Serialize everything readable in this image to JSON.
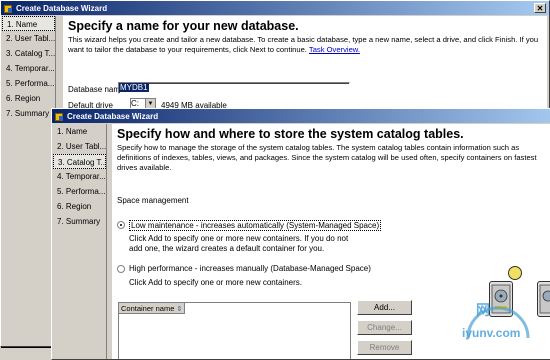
{
  "window_back": {
    "title": "Create Database Wizard",
    "nav": [
      "1. Name",
      "2. User Tabl...",
      "3. Catalog T...",
      "4. Temporar...",
      "5. Performa...",
      "6. Region",
      "7. Summary"
    ],
    "heading": "Specify a name for your new database.",
    "description": "This wizard helps you create and tailor a new database. To create a basic database, type a new name, select a drive, and click Finish. If you want to tailor the database to your requirements, click Next to continue.",
    "link": "Task Overview.",
    "db_name_label": "Database name",
    "db_name_value": "MYDB1",
    "drive_label": "Default drive",
    "drive_value": "C:",
    "drive_available": "4949 MB available"
  },
  "window_front": {
    "title": "Create Database Wizard",
    "nav": [
      "1. Name",
      "2. User Tabl...",
      "3. Catalog T...",
      "4. Temporar...",
      "5. Performa...",
      "6. Region",
      "7. Summary"
    ],
    "heading": "Specify how and where to store the system catalog tables.",
    "description": "Specify how to manage the storage of the system catalog tables. The system catalog tables contain information such as definitions of indexes, tables, views, and packages. Since the system catalog will be used often, specify containers on fastest drives available.",
    "space_management_label": "Space management",
    "option_low": "Low maintenance - increases automatically (System-Managed Space)",
    "option_low_desc": "Click Add to specify one or more new containers. If you do not add one, the wizard creates a default container for you.",
    "option_high": "High performance - increases manually (Database-Managed Space)",
    "option_high_desc": "Click Add to specify one or more new containers.",
    "list_header": "Container name",
    "buttons": {
      "add": "Add...",
      "change": "Change...",
      "remove": "Remove"
    }
  },
  "watermark": {
    "site": "iyunv.com",
    "cn": "网"
  }
}
